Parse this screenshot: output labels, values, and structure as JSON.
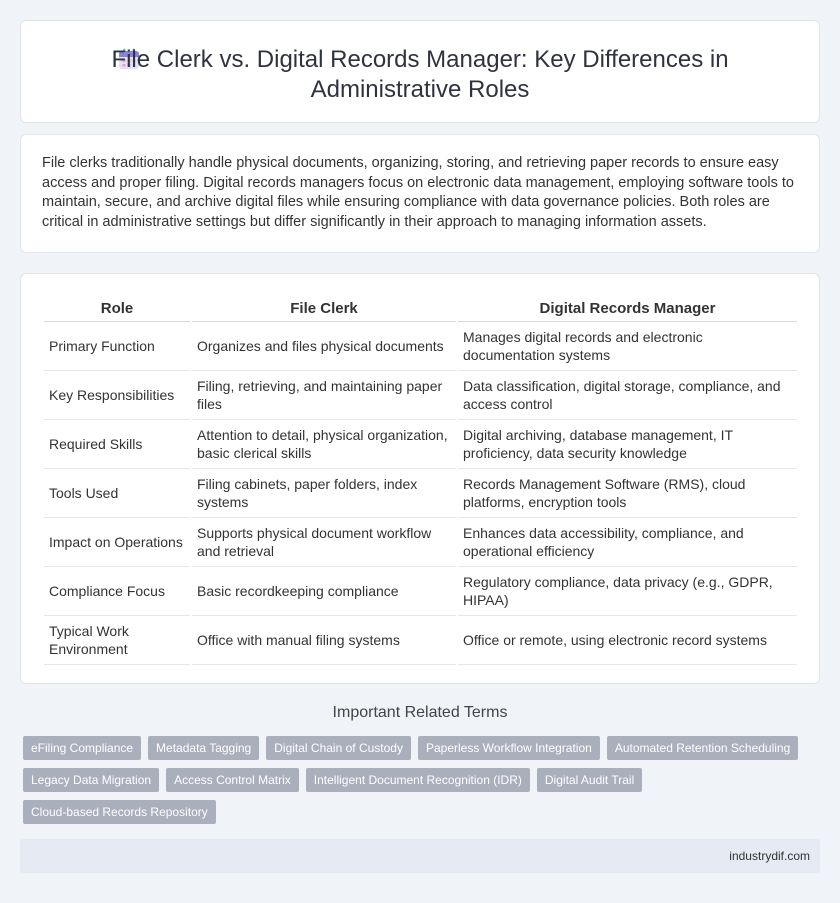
{
  "header": {
    "title": "File Clerk vs. Digital Records Manager: Key Differences in Administrative Roles",
    "icon": "calendar-icon"
  },
  "intro": {
    "text": "File clerks traditionally handle physical documents, organizing, storing, and retrieving paper records to ensure easy access and proper filing. Digital records managers focus on electronic data management, employing software tools to maintain, secure, and archive digital files while ensuring compliance with data governance policies. Both roles are critical in administrative settings but differ significantly in their approach to managing information assets."
  },
  "table": {
    "headers": [
      "Role",
      "File Clerk",
      "Digital Records Manager"
    ],
    "rows": [
      [
        "Primary Function",
        "Organizes and files physical documents",
        "Manages digital records and electronic documentation systems"
      ],
      [
        "Key Responsibilities",
        "Filing, retrieving, and maintaining paper files",
        "Data classification, digital storage, compliance, and access control"
      ],
      [
        "Required Skills",
        "Attention to detail, physical organization, basic clerical skills",
        "Digital archiving, database management, IT proficiency, data security knowledge"
      ],
      [
        "Tools Used",
        "Filing cabinets, paper folders, index systems",
        "Records Management Software (RMS), cloud platforms, encryption tools"
      ],
      [
        "Impact on Operations",
        "Supports physical document workflow and retrieval",
        "Enhances data accessibility, compliance, and operational efficiency"
      ],
      [
        "Compliance Focus",
        "Basic recordkeeping compliance",
        "Regulatory compliance, data privacy (e.g., GDPR, HIPAA)"
      ],
      [
        "Typical Work Environment",
        "Office with manual filing systems",
        "Office or remote, using electronic record systems"
      ]
    ]
  },
  "related": {
    "title": "Important Related Terms",
    "tags": [
      "eFiling Compliance",
      "Metadata Tagging",
      "Digital Chain of Custody",
      "Paperless Workflow Integration",
      "Automated Retention Scheduling",
      "Legacy Data Migration",
      "Access Control Matrix",
      "Intelligent Document Recognition (IDR)",
      "Digital Audit Trail",
      "Cloud-based Records Repository"
    ]
  },
  "footer": {
    "site": "industrydif.com"
  }
}
